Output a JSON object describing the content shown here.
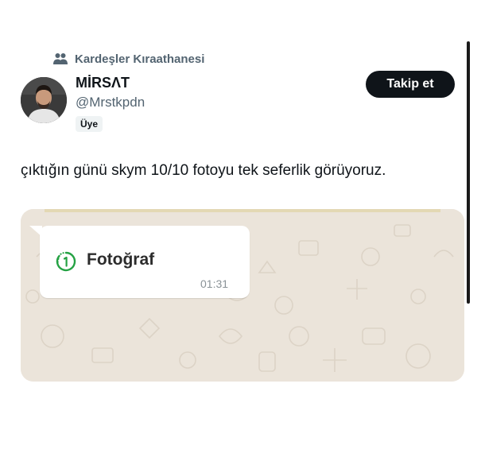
{
  "community": {
    "icon": "people-icon",
    "name": "Kardeşler Kıraathanesi"
  },
  "author": {
    "display_name": "MİRSΛT",
    "handle": "@Mrstkpdn",
    "role_badge": "Üye",
    "avatar": "avatar-photo"
  },
  "follow_button": {
    "label": "Takip et"
  },
  "tweet": {
    "text": "çıktığın günü skym 10/10 fotoyu tek seferlik görüyoruz."
  },
  "media": {
    "message": {
      "icon": "view-once-icon",
      "label": "Fotoğraf",
      "time": "01:31"
    }
  },
  "colors": {
    "text_primary": "#0f1419",
    "text_secondary": "#536471",
    "follow_bg": "#0f1419",
    "chat_wallpaper": "#ece5dd",
    "view_once_green": "#25a244"
  }
}
